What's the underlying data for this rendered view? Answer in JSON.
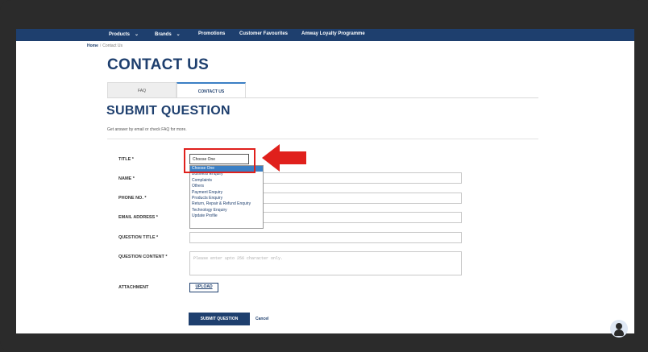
{
  "nav": {
    "items": [
      {
        "label": "Products",
        "has_chevron": true
      },
      {
        "label": "Brands",
        "has_chevron": true
      },
      {
        "label": "Promotions",
        "has_chevron": false
      },
      {
        "label": "Customer Favourites",
        "has_chevron": false
      },
      {
        "label": "Amway Loyalty Programme",
        "has_chevron": false
      }
    ],
    "chevron": "⌄"
  },
  "breadcrumb": {
    "home": "Home",
    "separator": "/",
    "current": "Contact Us"
  },
  "page_title": "CONTACT US",
  "tabs": [
    {
      "label": "FAQ",
      "active": false
    },
    {
      "label": "CONTACT US",
      "active": true
    }
  ],
  "section": {
    "title": "SUBMIT QUESTION",
    "subtitle": "Get answer by email or check FAQ for more."
  },
  "form": {
    "title_label": "TITLE *",
    "title_value": "Choose One",
    "name_label": "NAME *",
    "phone_label": "PHONE NO. *",
    "email_label": "EMAIL ADDRESS *",
    "question_title_label": "QUESTION TITLE *",
    "question_content_label": "QUESTION CONTENT *",
    "question_content_placeholder": "Please enter upto 256 character only.",
    "attachment_label": "ATTACHMENT",
    "upload_label": "UPLOAD",
    "submit_label": "SUBMIT QUESTION",
    "cancel_label": "Cancel"
  },
  "title_options": [
    "Choose One",
    "Business Enquiry",
    "Complaints",
    "Others",
    "Payment Enquiry",
    "Products Enquiry",
    "Return, Repair & Refund Enquiry",
    "Technology Enquiry",
    "Update Profile"
  ],
  "colors": {
    "brand": "#1e3f6e",
    "accent": "#3b7fc4",
    "highlight": "#e0201c"
  }
}
